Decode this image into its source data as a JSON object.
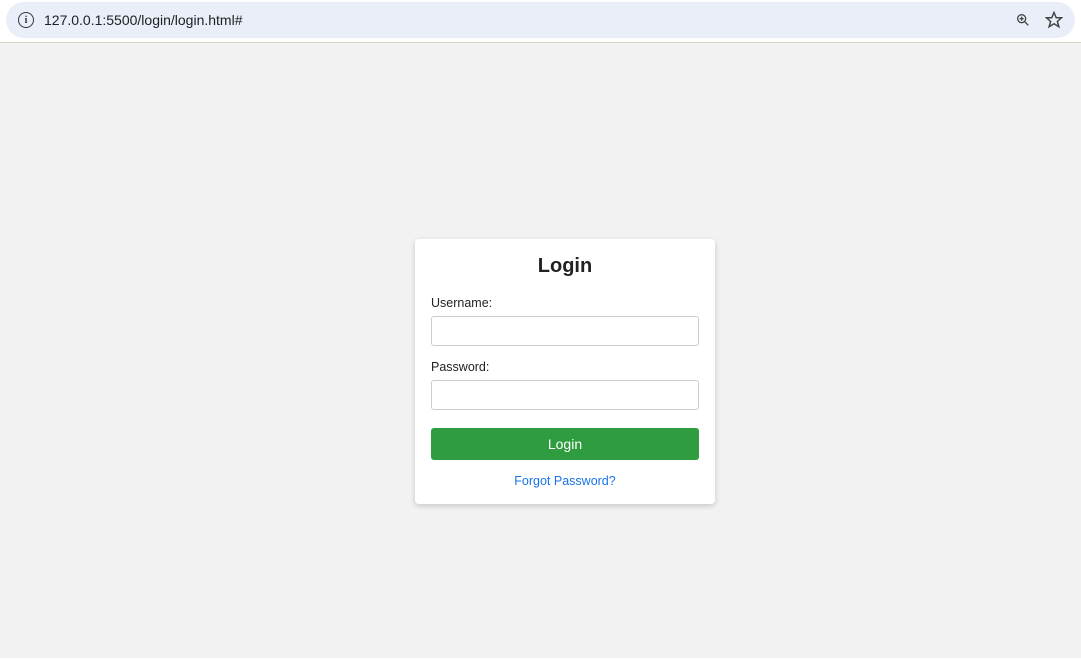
{
  "browser": {
    "url": "127.0.0.1:5500/login/login.html#"
  },
  "login": {
    "title": "Login",
    "username_label": "Username:",
    "username_value": "",
    "password_label": "Password:",
    "password_value": "",
    "submit_label": "Login",
    "forgot_label": "Forgot Password?"
  }
}
